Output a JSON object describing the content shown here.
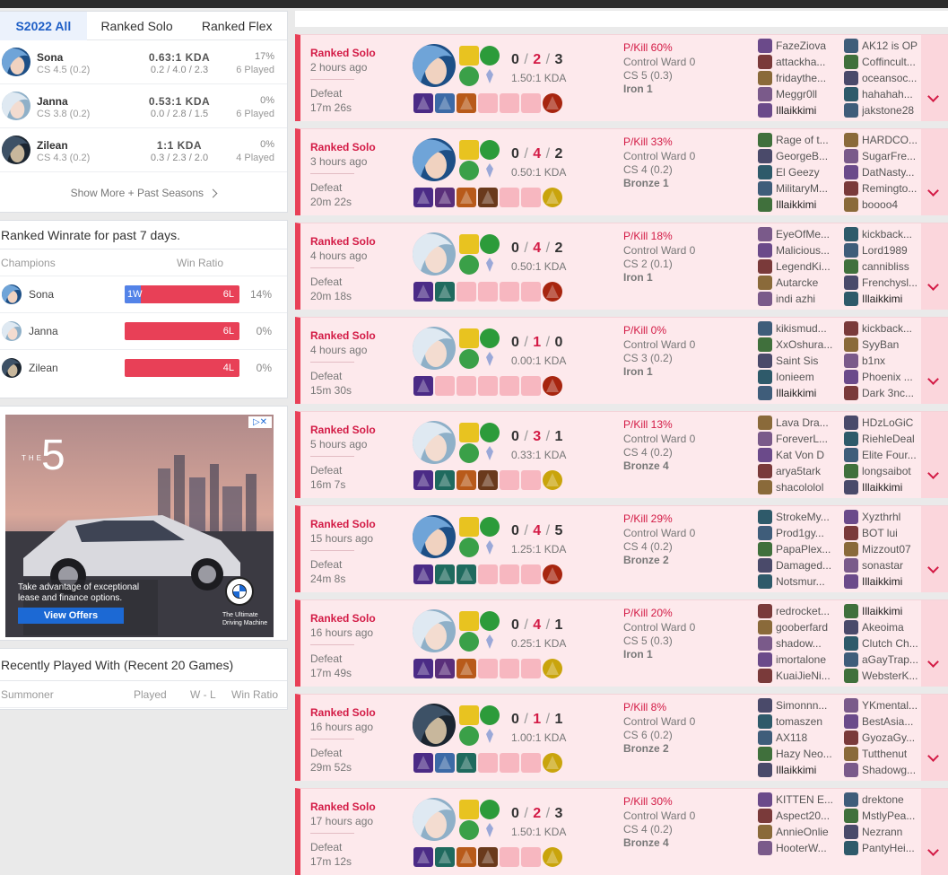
{
  "season_tabs": [
    "S2022 All",
    "Ranked Solo",
    "Ranked Flex"
  ],
  "champions": [
    {
      "name": "Sona",
      "cs": "CS 4.5 (0.2)",
      "kda": "0.63:1 KDA",
      "kda_detail": "0.2 / 4.0 / 2.3",
      "winrate": "17%",
      "played": "6 Played"
    },
    {
      "name": "Janna",
      "cs": "CS 3.8 (0.2)",
      "kda": "0.53:1 KDA",
      "kda_detail": "0.0 / 2.8 / 1.5",
      "winrate": "0%",
      "played": "6 Played"
    },
    {
      "name": "Zilean",
      "cs": "CS 4.3 (0.2)",
      "kda": "1:1 KDA",
      "kda_detail": "0.3 / 2.3 / 2.0",
      "winrate": "0%",
      "played": "4 Played"
    }
  ],
  "show_more": "Show More + Past Seasons",
  "winrate_card": {
    "title": "Ranked Winrate for past 7 days.",
    "col_champions": "Champions",
    "col_ratio": "Win Ratio",
    "rows": [
      {
        "name": "Sona",
        "wins": "1W",
        "losses": "6L",
        "win_fraction": 0.14,
        "pct": "14%"
      },
      {
        "name": "Janna",
        "wins": "",
        "losses": "6L",
        "win_fraction": 0,
        "pct": "0%"
      },
      {
        "name": "Zilean",
        "wins": "",
        "losses": "4L",
        "win_fraction": 0,
        "pct": "0%"
      }
    ]
  },
  "ad": {
    "headline_number": "5",
    "small_text": "THE",
    "body": "Take advantage of exceptional lease and finance options.",
    "button": "View Offers",
    "brand": "BMW",
    "tagline_1": "The Ultimate",
    "tagline_2": "Driving Machine"
  },
  "recent": {
    "title": "Recently Played With (Recent 20 Games)",
    "col_summoner": "Summoner",
    "col_played": "Played",
    "col_wl": "W - L",
    "col_ratio": "Win Ratio"
  },
  "colors": {
    "loss": "#e84057",
    "win": "#5383e8",
    "accent": "#1f5fc6"
  },
  "matches": [
    {
      "queue": "Ranked Solo",
      "time": "2 hours ago",
      "result": "Defeat",
      "duration": "17m 26s",
      "champ": "sona",
      "kills": "0",
      "deaths": "2",
      "assists": "3",
      "kda_ratio": "1.50:1 KDA",
      "pkill": "P/Kill 60%",
      "ward": "Control Ward 0",
      "cs": "CS 5 (0.3)",
      "rank": "Iron 1",
      "items": [
        "purple",
        "blue",
        "orange",
        "",
        "",
        "",
        "red"
      ],
      "team1": [
        "FazeZiova",
        "attackha...",
        "fridaythe...",
        "Meggr0ll",
        "Illaikkimi"
      ],
      "team2": [
        "AK12 is OP",
        "Coffincult...",
        "oceansoc...",
        "hahahah...",
        "jakstone28"
      ]
    },
    {
      "queue": "Ranked Solo",
      "time": "3 hours ago",
      "result": "Defeat",
      "duration": "20m 22s",
      "champ": "sona",
      "kills": "0",
      "deaths": "4",
      "assists": "2",
      "kda_ratio": "0.50:1 KDA",
      "pkill": "P/Kill 33%",
      "ward": "Control Ward 0",
      "cs": "CS 4 (0.2)",
      "rank": "Bronze 1",
      "items": [
        "purple",
        "violet",
        "orange",
        "brown",
        "",
        "",
        "gold"
      ],
      "team1": [
        "Rage of t...",
        "GeorgeB...",
        "El Geezy",
        "MilitaryM...",
        "Illaikkimi"
      ],
      "team2": [
        "HARDCO...",
        "SugarFre...",
        "DatNasty...",
        "Remingto...",
        "boooo4"
      ]
    },
    {
      "queue": "Ranked Solo",
      "time": "4 hours ago",
      "result": "Defeat",
      "duration": "20m 18s",
      "champ": "janna",
      "kills": "0",
      "deaths": "4",
      "assists": "2",
      "kda_ratio": "0.50:1 KDA",
      "pkill": "P/Kill 18%",
      "ward": "Control Ward 0",
      "cs": "CS 2 (0.1)",
      "rank": "Iron 1",
      "items": [
        "purple",
        "teal",
        "",
        "",
        "",
        "",
        "red"
      ],
      "team1": [
        "EyeOfMe...",
        "Malicious...",
        "LegendKi...",
        "Autarcke",
        "indi azhi"
      ],
      "team2": [
        "kickback...",
        "Lord1989",
        "cannibliss",
        "Frenchysl...",
        "Illaikkimi"
      ]
    },
    {
      "queue": "Ranked Solo",
      "time": "4 hours ago",
      "result": "Defeat",
      "duration": "15m 30s",
      "champ": "janna",
      "kills": "0",
      "deaths": "1",
      "assists": "0",
      "kda_ratio": "0.00:1 KDA",
      "pkill": "P/Kill 0%",
      "ward": "Control Ward 0",
      "cs": "CS 3 (0.2)",
      "rank": "Iron 1",
      "items": [
        "purple",
        "",
        "",
        "",
        "",
        "",
        "red"
      ],
      "team1": [
        "kikismud...",
        "XxOshura...",
        "Saint Sis",
        "Ionieem",
        "Illaikkimi"
      ],
      "team2": [
        "kickback...",
        "SyyBan",
        "b1nx",
        "Phoenix ...",
        "Dark 3nc..."
      ]
    },
    {
      "queue": "Ranked Solo",
      "time": "5 hours ago",
      "result": "Defeat",
      "duration": "16m 7s",
      "champ": "janna",
      "kills": "0",
      "deaths": "3",
      "assists": "1",
      "kda_ratio": "0.33:1 KDA",
      "pkill": "P/Kill 13%",
      "ward": "Control Ward 0",
      "cs": "CS 4 (0.2)",
      "rank": "Bronze 4",
      "items": [
        "purple",
        "teal",
        "orange",
        "brown",
        "",
        "",
        "gold"
      ],
      "team1": [
        "Lava Dra...",
        "ForeverL...",
        "Kat Von D",
        "arya5tark",
        "shacololol"
      ],
      "team2": [
        "HDzLoGiC",
        "RiehleDeal",
        "Elite Four...",
        "longsaibot",
        "Illaikkimi"
      ]
    },
    {
      "queue": "Ranked Solo",
      "time": "15 hours ago",
      "result": "Defeat",
      "duration": "24m 8s",
      "champ": "sona",
      "kills": "0",
      "deaths": "4",
      "assists": "5",
      "kda_ratio": "1.25:1 KDA",
      "pkill": "P/Kill 29%",
      "ward": "Control Ward 0",
      "cs": "CS 4 (0.2)",
      "rank": "Bronze 2",
      "items": [
        "purple",
        "teal",
        "teal",
        "",
        "",
        "",
        "red"
      ],
      "team1": [
        "StrokeMy...",
        "Prod1gy...",
        "PapaPlex...",
        "Damaged...",
        "Notsmur..."
      ],
      "team2": [
        "Xyzthrhl",
        "BOT lui",
        "Mizzout07",
        "sonastar",
        "Illaikkimi"
      ]
    },
    {
      "queue": "Ranked Solo",
      "time": "16 hours ago",
      "result": "Defeat",
      "duration": "17m 49s",
      "champ": "janna",
      "kills": "0",
      "deaths": "4",
      "assists": "1",
      "kda_ratio": "0.25:1 KDA",
      "pkill": "P/Kill 20%",
      "ward": "Control Ward 0",
      "cs": "CS 5 (0.3)",
      "rank": "Iron 1",
      "items": [
        "purple",
        "violet",
        "orange",
        "",
        "",
        "",
        "gold"
      ],
      "team1": [
        "redrocket...",
        "gooberfard",
        "shadow...",
        "imortalone",
        "KuaiJieNi..."
      ],
      "team2": [
        "Illaikkimi",
        "Akeoima",
        "Clutch Ch...",
        "aGayTrap...",
        "WebsterK..."
      ]
    },
    {
      "queue": "Ranked Solo",
      "time": "16 hours ago",
      "result": "Defeat",
      "duration": "29m 52s",
      "champ": "zilean",
      "kills": "0",
      "deaths": "1",
      "assists": "1",
      "kda_ratio": "1.00:1 KDA",
      "pkill": "P/Kill 8%",
      "ward": "Control Ward 0",
      "cs": "CS 6 (0.2)",
      "rank": "Bronze 2",
      "items": [
        "purple",
        "blue",
        "teal",
        "",
        "",
        "",
        "gold"
      ],
      "team1": [
        "Simonnn...",
        "tomaszen",
        "AX118",
        "Hazy Neo...",
        "Illaikkimi"
      ],
      "team2": [
        "YKmental...",
        "BestAsia...",
        "GyozaGy...",
        "Tutthenut",
        "Shadowg..."
      ]
    },
    {
      "queue": "Ranked Solo",
      "time": "17 hours ago",
      "result": "Defeat",
      "duration": "17m 12s",
      "champ": "janna",
      "kills": "0",
      "deaths": "2",
      "assists": "3",
      "kda_ratio": "1.50:1 KDA",
      "pkill": "P/Kill 30%",
      "ward": "Control Ward 0",
      "cs": "CS 4 (0.2)",
      "rank": "Bronze 4",
      "items": [
        "purple",
        "teal",
        "orange",
        "brown",
        "",
        "",
        "gold"
      ],
      "team1": [
        "KITTEN E...",
        "Aspect20...",
        "AnnieOnlie",
        "HooterW...",
        ""
      ],
      "team2": [
        "drektone",
        "MstlyPea...",
        "Nezrann",
        "PantyHei...",
        ""
      ]
    }
  ]
}
